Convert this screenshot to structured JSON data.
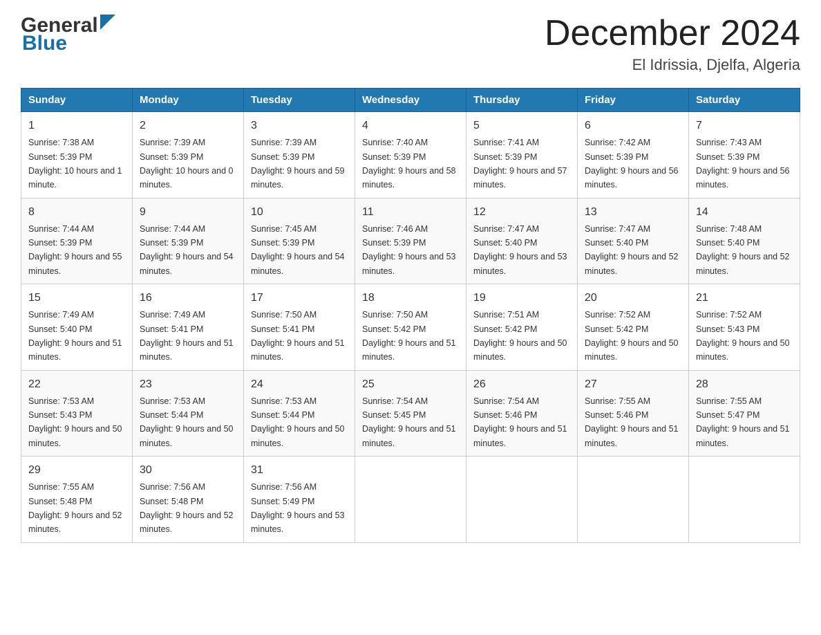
{
  "header": {
    "logo_general": "General",
    "logo_blue": "Blue",
    "month_title": "December 2024",
    "location": "El Idrissia, Djelfa, Algeria"
  },
  "weekdays": [
    "Sunday",
    "Monday",
    "Tuesday",
    "Wednesday",
    "Thursday",
    "Friday",
    "Saturday"
  ],
  "weeks": [
    [
      {
        "day": "1",
        "sunrise": "7:38 AM",
        "sunset": "5:39 PM",
        "daylight": "10 hours and 1 minute."
      },
      {
        "day": "2",
        "sunrise": "7:39 AM",
        "sunset": "5:39 PM",
        "daylight": "10 hours and 0 minutes."
      },
      {
        "day": "3",
        "sunrise": "7:39 AM",
        "sunset": "5:39 PM",
        "daylight": "9 hours and 59 minutes."
      },
      {
        "day": "4",
        "sunrise": "7:40 AM",
        "sunset": "5:39 PM",
        "daylight": "9 hours and 58 minutes."
      },
      {
        "day": "5",
        "sunrise": "7:41 AM",
        "sunset": "5:39 PM",
        "daylight": "9 hours and 57 minutes."
      },
      {
        "day": "6",
        "sunrise": "7:42 AM",
        "sunset": "5:39 PM",
        "daylight": "9 hours and 56 minutes."
      },
      {
        "day": "7",
        "sunrise": "7:43 AM",
        "sunset": "5:39 PM",
        "daylight": "9 hours and 56 minutes."
      }
    ],
    [
      {
        "day": "8",
        "sunrise": "7:44 AM",
        "sunset": "5:39 PM",
        "daylight": "9 hours and 55 minutes."
      },
      {
        "day": "9",
        "sunrise": "7:44 AM",
        "sunset": "5:39 PM",
        "daylight": "9 hours and 54 minutes."
      },
      {
        "day": "10",
        "sunrise": "7:45 AM",
        "sunset": "5:39 PM",
        "daylight": "9 hours and 54 minutes."
      },
      {
        "day": "11",
        "sunrise": "7:46 AM",
        "sunset": "5:39 PM",
        "daylight": "9 hours and 53 minutes."
      },
      {
        "day": "12",
        "sunrise": "7:47 AM",
        "sunset": "5:40 PM",
        "daylight": "9 hours and 53 minutes."
      },
      {
        "day": "13",
        "sunrise": "7:47 AM",
        "sunset": "5:40 PM",
        "daylight": "9 hours and 52 minutes."
      },
      {
        "day": "14",
        "sunrise": "7:48 AM",
        "sunset": "5:40 PM",
        "daylight": "9 hours and 52 minutes."
      }
    ],
    [
      {
        "day": "15",
        "sunrise": "7:49 AM",
        "sunset": "5:40 PM",
        "daylight": "9 hours and 51 minutes."
      },
      {
        "day": "16",
        "sunrise": "7:49 AM",
        "sunset": "5:41 PM",
        "daylight": "9 hours and 51 minutes."
      },
      {
        "day": "17",
        "sunrise": "7:50 AM",
        "sunset": "5:41 PM",
        "daylight": "9 hours and 51 minutes."
      },
      {
        "day": "18",
        "sunrise": "7:50 AM",
        "sunset": "5:42 PM",
        "daylight": "9 hours and 51 minutes."
      },
      {
        "day": "19",
        "sunrise": "7:51 AM",
        "sunset": "5:42 PM",
        "daylight": "9 hours and 50 minutes."
      },
      {
        "day": "20",
        "sunrise": "7:52 AM",
        "sunset": "5:42 PM",
        "daylight": "9 hours and 50 minutes."
      },
      {
        "day": "21",
        "sunrise": "7:52 AM",
        "sunset": "5:43 PM",
        "daylight": "9 hours and 50 minutes."
      }
    ],
    [
      {
        "day": "22",
        "sunrise": "7:53 AM",
        "sunset": "5:43 PM",
        "daylight": "9 hours and 50 minutes."
      },
      {
        "day": "23",
        "sunrise": "7:53 AM",
        "sunset": "5:44 PM",
        "daylight": "9 hours and 50 minutes."
      },
      {
        "day": "24",
        "sunrise": "7:53 AM",
        "sunset": "5:44 PM",
        "daylight": "9 hours and 50 minutes."
      },
      {
        "day": "25",
        "sunrise": "7:54 AM",
        "sunset": "5:45 PM",
        "daylight": "9 hours and 51 minutes."
      },
      {
        "day": "26",
        "sunrise": "7:54 AM",
        "sunset": "5:46 PM",
        "daylight": "9 hours and 51 minutes."
      },
      {
        "day": "27",
        "sunrise": "7:55 AM",
        "sunset": "5:46 PM",
        "daylight": "9 hours and 51 minutes."
      },
      {
        "day": "28",
        "sunrise": "7:55 AM",
        "sunset": "5:47 PM",
        "daylight": "9 hours and 51 minutes."
      }
    ],
    [
      {
        "day": "29",
        "sunrise": "7:55 AM",
        "sunset": "5:48 PM",
        "daylight": "9 hours and 52 minutes."
      },
      {
        "day": "30",
        "sunrise": "7:56 AM",
        "sunset": "5:48 PM",
        "daylight": "9 hours and 52 minutes."
      },
      {
        "day": "31",
        "sunrise": "7:56 AM",
        "sunset": "5:49 PM",
        "daylight": "9 hours and 53 minutes."
      },
      null,
      null,
      null,
      null
    ]
  ]
}
